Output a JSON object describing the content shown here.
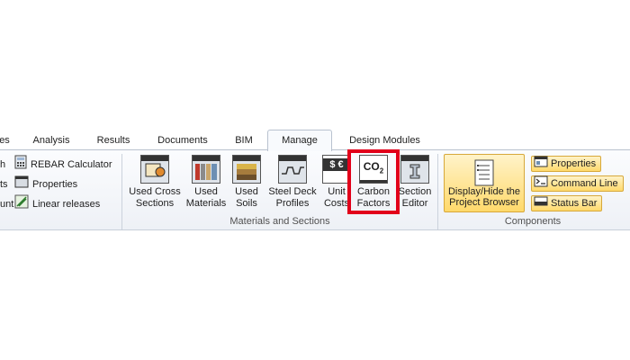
{
  "tabs": [
    {
      "label": "es"
    },
    {
      "label": "Analysis"
    },
    {
      "label": "Results"
    },
    {
      "label": "Documents"
    },
    {
      "label": "BIM"
    },
    {
      "label": "Manage",
      "active": true
    },
    {
      "label": "Design Modules"
    }
  ],
  "left_group": {
    "rows": [
      {
        "prefix": "h",
        "label": "REBAR Calculator",
        "icon": "calculator-icon"
      },
      {
        "prefix": "ts",
        "label": "Properties",
        "icon": "properties-icon"
      },
      {
        "prefix": "unt",
        "label": "Linear releases",
        "icon": "linear-releases-icon"
      }
    ]
  },
  "materials_group": {
    "label": "Materials and Sections",
    "buttons": [
      {
        "line1": "Used Cross",
        "line2": "Sections",
        "icon": "cross-sections-icon"
      },
      {
        "line1": "Used",
        "line2": "Materials",
        "icon": "materials-icon"
      },
      {
        "line1": "Used",
        "line2": "Soils",
        "icon": "soils-icon"
      },
      {
        "line1": "Steel Deck",
        "line2": "Profiles",
        "icon": "steel-deck-icon"
      },
      {
        "line1": "Unit",
        "line2": "Costs",
        "icon": "unit-costs-icon",
        "glyph": "$ €"
      },
      {
        "line1": "Carbon",
        "line2": "Factors",
        "icon": "co2-icon",
        "glyph": "CO2",
        "highlighted": true
      },
      {
        "line1": "Section",
        "line2": "Editor",
        "icon": "section-editor-icon"
      }
    ]
  },
  "components_group": {
    "label": "Components",
    "display_button": {
      "line1": "Display/Hide the",
      "line2": "Project Browser"
    },
    "toggles": [
      {
        "label": "Properties",
        "icon": "properties-panel-icon"
      },
      {
        "label": "Command Line",
        "icon": "command-line-icon"
      },
      {
        "label": "Status Bar",
        "icon": "status-bar-icon"
      }
    ]
  },
  "colors": {
    "highlight": "#e2001a",
    "active_toggle": "#ffd96b"
  }
}
